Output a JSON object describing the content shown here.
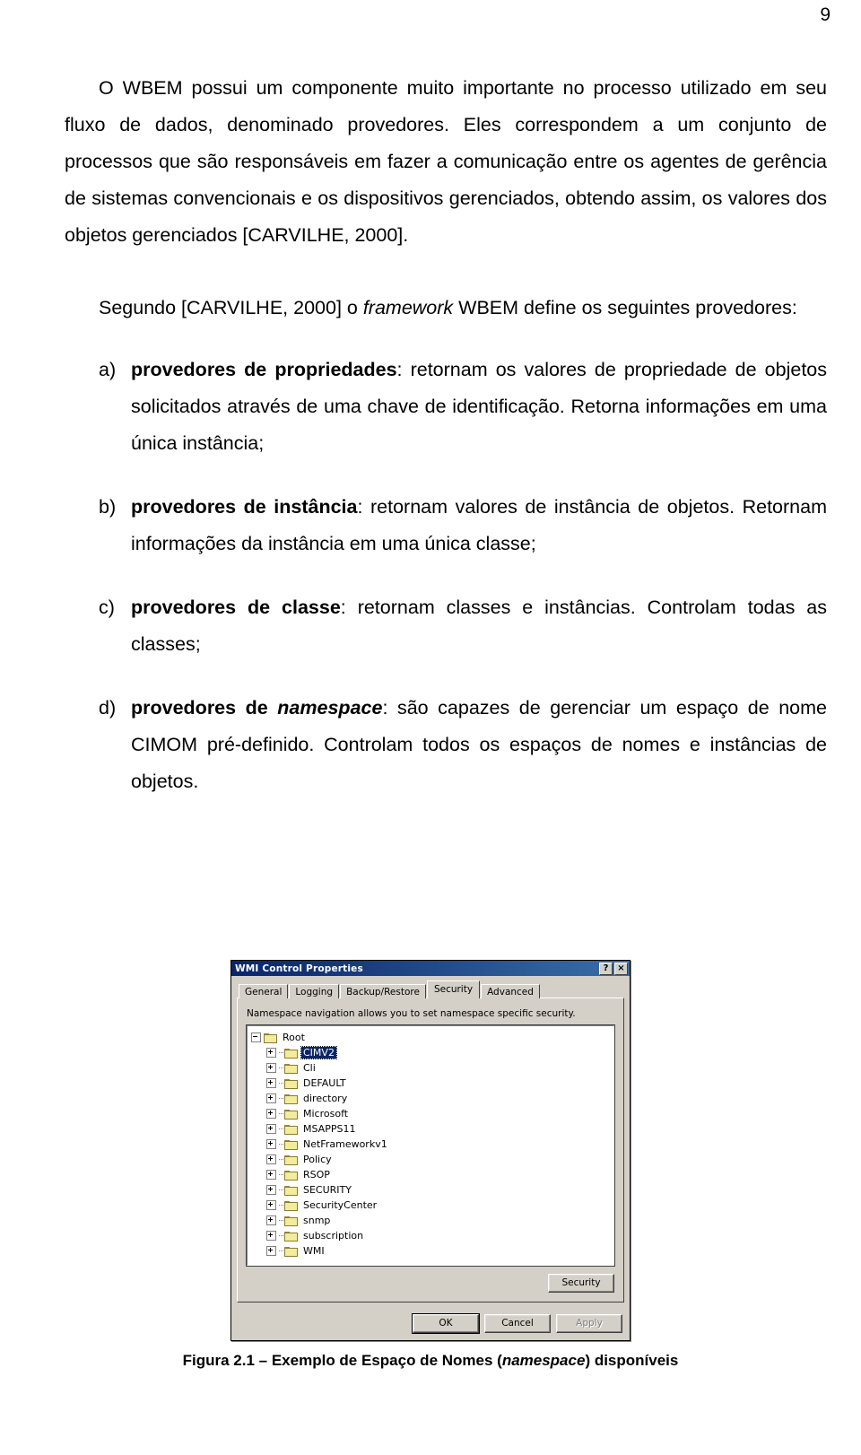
{
  "page": {
    "number": "9"
  },
  "document": {
    "paragraph1": {
      "part1": "O WBEM possui um componente muito importante no processo utilizado em seu fluxo de dados, denominado provedores. Eles correspondem a um conjunto de processos que são responsáveis em fazer a comunicação entre os agentes de gerência de sistemas convencionais e os dispositivos gerenciados, obtendo assim, os valores dos objetos gerenciados [CARVILHE, 2000]."
    },
    "paragraph2": {
      "before_italic": "Segundo [CARVILHE, 2000] o ",
      "italic": "framework",
      "after_italic": " WBEM define os seguintes provedores:"
    },
    "list": [
      {
        "marker": "a)",
        "bold": "provedores de propriedades",
        "bold_italic": "",
        "rest": ": retornam os valores de propriedade de objetos solicitados através de uma chave de identificação. Retorna informações em uma única instância;"
      },
      {
        "marker": "b)",
        "bold": "provedores de instância",
        "bold_italic": "",
        "rest": ": retornam valores de instância de objetos. Retornam informações da instância em uma única classe;"
      },
      {
        "marker": "c)",
        "bold": "provedores de classe",
        "bold_italic": "",
        "rest": ": retornam classes e instâncias. Controlam todas as classes;"
      },
      {
        "marker": "d)",
        "bold": "provedores de ",
        "bold_italic": "namespace",
        "rest": ": são capazes de gerenciar um espaço de nome CIMOM pré-definido. Controlam todos os espaços de nomes e instâncias de objetos."
      }
    ]
  },
  "figure": {
    "caption_before_italic": "Figura 2.1 – Exemplo de Espaço de Nomes (",
    "caption_italic": "namespace",
    "caption_after_italic": ") disponíveis",
    "dialog": {
      "title": "WMI Control Properties",
      "help_button": "?",
      "close_button": "×",
      "tabs": [
        {
          "label": "General",
          "active": false
        },
        {
          "label": "Logging",
          "active": false
        },
        {
          "label": "Backup/Restore",
          "active": false
        },
        {
          "label": "Security",
          "active": true
        },
        {
          "label": "Advanced",
          "active": false
        }
      ],
      "panel_description": "Namespace navigation allows you to set namespace specific security.",
      "tree": [
        {
          "label": "Root",
          "level": 0,
          "toggle": "minus",
          "selected": false
        },
        {
          "label": "CIMV2",
          "level": 1,
          "toggle": "plus",
          "selected": true
        },
        {
          "label": "Cli",
          "level": 1,
          "toggle": "plus",
          "selected": false
        },
        {
          "label": "DEFAULT",
          "level": 1,
          "toggle": "plus",
          "selected": false
        },
        {
          "label": "directory",
          "level": 1,
          "toggle": "plus",
          "selected": false
        },
        {
          "label": "Microsoft",
          "level": 1,
          "toggle": "plus",
          "selected": false
        },
        {
          "label": "MSAPPS11",
          "level": 1,
          "toggle": "plus",
          "selected": false
        },
        {
          "label": "NetFrameworkv1",
          "level": 1,
          "toggle": "plus",
          "selected": false
        },
        {
          "label": "Policy",
          "level": 1,
          "toggle": "plus",
          "selected": false
        },
        {
          "label": "RSOP",
          "level": 1,
          "toggle": "plus",
          "selected": false
        },
        {
          "label": "SECURITY",
          "level": 1,
          "toggle": "plus",
          "selected": false
        },
        {
          "label": "SecurityCenter",
          "level": 1,
          "toggle": "plus",
          "selected": false
        },
        {
          "label": "snmp",
          "level": 1,
          "toggle": "plus",
          "selected": false
        },
        {
          "label": "subscription",
          "level": 1,
          "toggle": "plus",
          "selected": false
        },
        {
          "label": "WMI",
          "level": 1,
          "toggle": "plus",
          "selected": false
        }
      ],
      "security_button": "Security",
      "ok_button": "OK",
      "cancel_button": "Cancel",
      "apply_button": "Apply",
      "colors": {
        "titlebar_start": "#0a246a",
        "titlebar_end": "#3a6ea5",
        "face": "#d4d0c8",
        "selection": "#0a246a",
        "folder": "#f2ec9c"
      }
    }
  }
}
